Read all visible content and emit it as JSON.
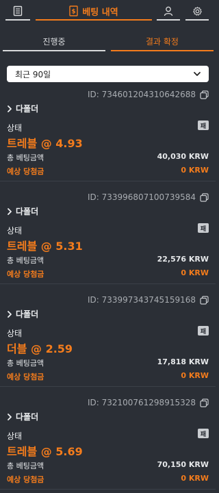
{
  "header": {
    "bets_label": "베팅 내역"
  },
  "tabs": {
    "in_progress": "진행중",
    "confirmed": "결과 확정"
  },
  "filter": {
    "selected": "최근 90일"
  },
  "bets": [
    {
      "id": "ID: 734601204310642688",
      "type": "다폴더",
      "status_label": "상태",
      "status_badge": "패",
      "odds": "트레블 @ 4.93",
      "total_label": "총 베팅금액",
      "total_value": "40,030 KRW",
      "expected_label": "예상 당첨금",
      "expected_value": "0 KRW"
    },
    {
      "id": "ID: 733996807100739584",
      "type": "다폴더",
      "status_label": "상태",
      "status_badge": "패",
      "odds": "트레블 @ 5.31",
      "total_label": "총 베팅금액",
      "total_value": "22,576 KRW",
      "expected_label": "예상 당첨금",
      "expected_value": "0 KRW"
    },
    {
      "id": "ID: 733997343745159168",
      "type": "다폴더",
      "status_label": "상태",
      "status_badge": "패",
      "odds": "더블 @ 2.59",
      "total_label": "총 베팅금액",
      "total_value": "17,818 KRW",
      "expected_label": "예상 당첨금",
      "expected_value": "0 KRW"
    },
    {
      "id": "ID: 732100761298915328",
      "type": "다폴더",
      "status_label": "상태",
      "status_badge": "패",
      "odds": "트레블 @ 5.69",
      "total_label": "총 베팅금액",
      "total_value": "70,150 KRW",
      "expected_label": "예상 당첨금",
      "expected_value": "0 KRW"
    }
  ],
  "colors": {
    "accent": "#f47c1c",
    "background": "#2b2f36"
  }
}
